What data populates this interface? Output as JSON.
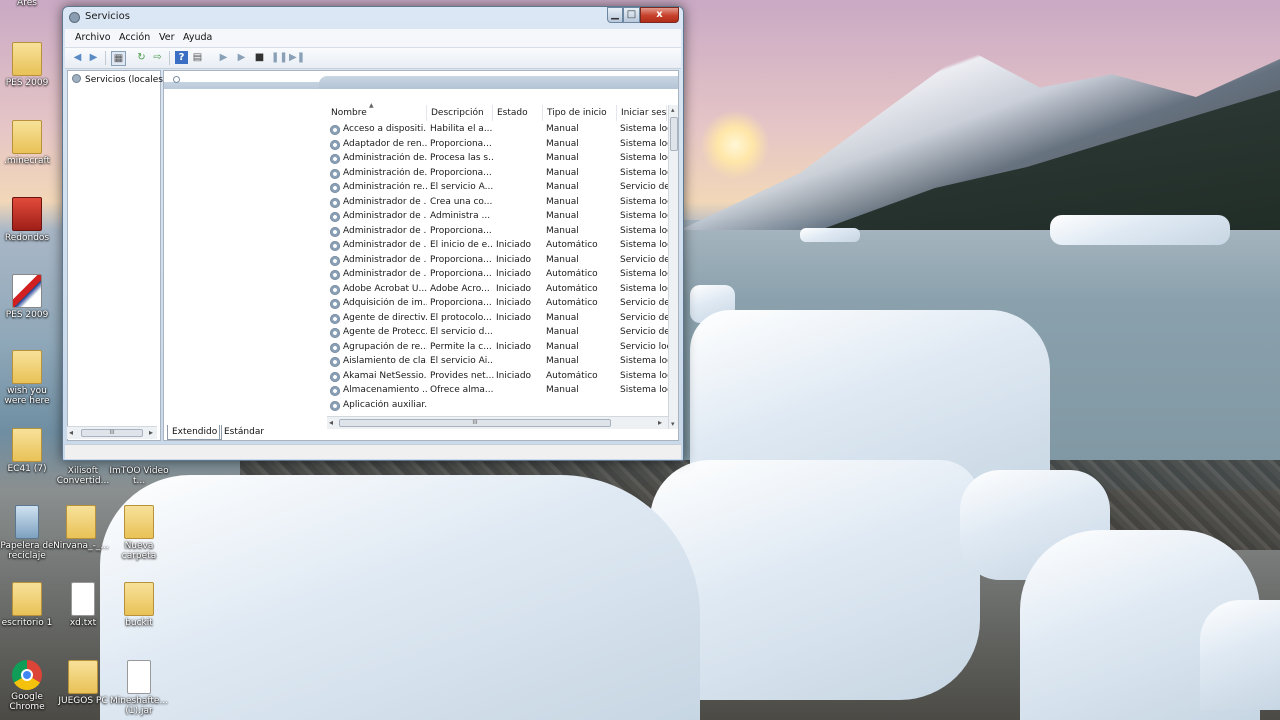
{
  "desktop": {
    "icons": [
      {
        "label": "Ares",
        "icon": "ares-icon"
      },
      {
        "label": "PES 2009",
        "icon": "pes-folder-icon"
      },
      {
        "label": ".minecraft",
        "icon": "folder-icon"
      },
      {
        "label": "Redondos",
        "icon": "red-app-icon"
      },
      {
        "label": "PES 2009",
        "icon": "pes-game-icon"
      },
      {
        "label": "wish you were here",
        "icon": "folder-icon"
      },
      {
        "label": "EC41 (7)",
        "icon": "folder-icon"
      },
      {
        "label": "Xilisoft Convertid...",
        "icon": "xilisoft-icon"
      },
      {
        "label": "ImTOO Video t...",
        "icon": "imtoo-icon"
      },
      {
        "label": "Papelera de reciclaje",
        "icon": "recycle-bin-icon"
      },
      {
        "label": "Nirvana_-_...",
        "icon": "folder-icon"
      },
      {
        "label": "Nueva carpeta",
        "icon": "folder-icon"
      },
      {
        "label": "escritorio 1",
        "icon": "folder-icon"
      },
      {
        "label": "xd.txt",
        "icon": "text-file-icon"
      },
      {
        "label": "buckit",
        "icon": "folder-icon"
      },
      {
        "label": "Google Chrome",
        "icon": "chrome-icon"
      },
      {
        "label": "JUEGOS PC",
        "icon": "folder-icon"
      },
      {
        "label": "Mineshafte... (1).jar",
        "icon": "java-file-icon"
      }
    ]
  },
  "window": {
    "title": "Servicios",
    "controls": {
      "minimize": "▁",
      "maximize": "□",
      "close": "x"
    },
    "menu": [
      "Archivo",
      "Acción",
      "Ver",
      "Ayuda"
    ],
    "tree_item": "Servicios (locales)",
    "columns": [
      "Nombre",
      "Descripción",
      "Estado",
      "Tipo de inicio",
      "Iniciar sesió"
    ],
    "rows": [
      {
        "name": "Acceso a dispositi...",
        "desc": "Habilita el a...",
        "state": "",
        "start": "Manual",
        "logon": "Sistema loc"
      },
      {
        "name": "Adaptador de ren...",
        "desc": "Proporciona...",
        "state": "",
        "start": "Manual",
        "logon": "Sistema loc"
      },
      {
        "name": "Administración de...",
        "desc": "Procesa las s...",
        "state": "",
        "start": "Manual",
        "logon": "Sistema loc"
      },
      {
        "name": "Administración de...",
        "desc": "Proporciona...",
        "state": "",
        "start": "Manual",
        "logon": "Sistema loc"
      },
      {
        "name": "Administración re...",
        "desc": "El servicio A...",
        "state": "",
        "start": "Manual",
        "logon": "Servicio de"
      },
      {
        "name": "Administrador de ...",
        "desc": "Crea una co...",
        "state": "",
        "start": "Manual",
        "logon": "Sistema loc"
      },
      {
        "name": "Administrador de ...",
        "desc": "Administra ...",
        "state": "",
        "start": "Manual",
        "logon": "Sistema loc"
      },
      {
        "name": "Administrador de ...",
        "desc": "Proporciona...",
        "state": "",
        "start": "Manual",
        "logon": "Sistema loc"
      },
      {
        "name": "Administrador de ...",
        "desc": "El inicio de e...",
        "state": "Iniciado",
        "start": "Automático",
        "logon": "Sistema loc"
      },
      {
        "name": "Administrador de ...",
        "desc": "Proporciona...",
        "state": "Iniciado",
        "start": "Manual",
        "logon": "Servicio de"
      },
      {
        "name": "Administrador de ...",
        "desc": "Proporciona...",
        "state": "Iniciado",
        "start": "Automático",
        "logon": "Sistema loc"
      },
      {
        "name": "Adobe Acrobat U...",
        "desc": "Adobe Acro...",
        "state": "Iniciado",
        "start": "Automático",
        "logon": "Sistema loc"
      },
      {
        "name": "Adquisición de im...",
        "desc": "Proporciona...",
        "state": "Iniciado",
        "start": "Automático",
        "logon": "Servicio de"
      },
      {
        "name": "Agente de directiv...",
        "desc": "El protocolo...",
        "state": "Iniciado",
        "start": "Manual",
        "logon": "Servicio de"
      },
      {
        "name": "Agente de Protecc...",
        "desc": "El servicio d...",
        "state": "",
        "start": "Manual",
        "logon": "Servicio de"
      },
      {
        "name": "Agrupación de re...",
        "desc": "Permite la c...",
        "state": "Iniciado",
        "start": "Manual",
        "logon": "Servicio loc"
      },
      {
        "name": "Aislamiento de cla...",
        "desc": "El servicio Ai...",
        "state": "",
        "start": "Manual",
        "logon": "Sistema loc"
      },
      {
        "name": "Akamai NetSessio...",
        "desc": "Provides net...",
        "state": "Iniciado",
        "start": "Automático",
        "logon": "Sistema loc"
      },
      {
        "name": "Almacenamiento ...",
        "desc": "Ofrece alma...",
        "state": "",
        "start": "Manual",
        "logon": "Sistema loc"
      },
      {
        "name": "Aplicación auxiliar...",
        "desc": "",
        "state": "",
        "start": "",
        "logon": ""
      }
    ],
    "tabs": [
      "Extendido",
      "Estándar"
    ],
    "scroll_grip": "III"
  }
}
